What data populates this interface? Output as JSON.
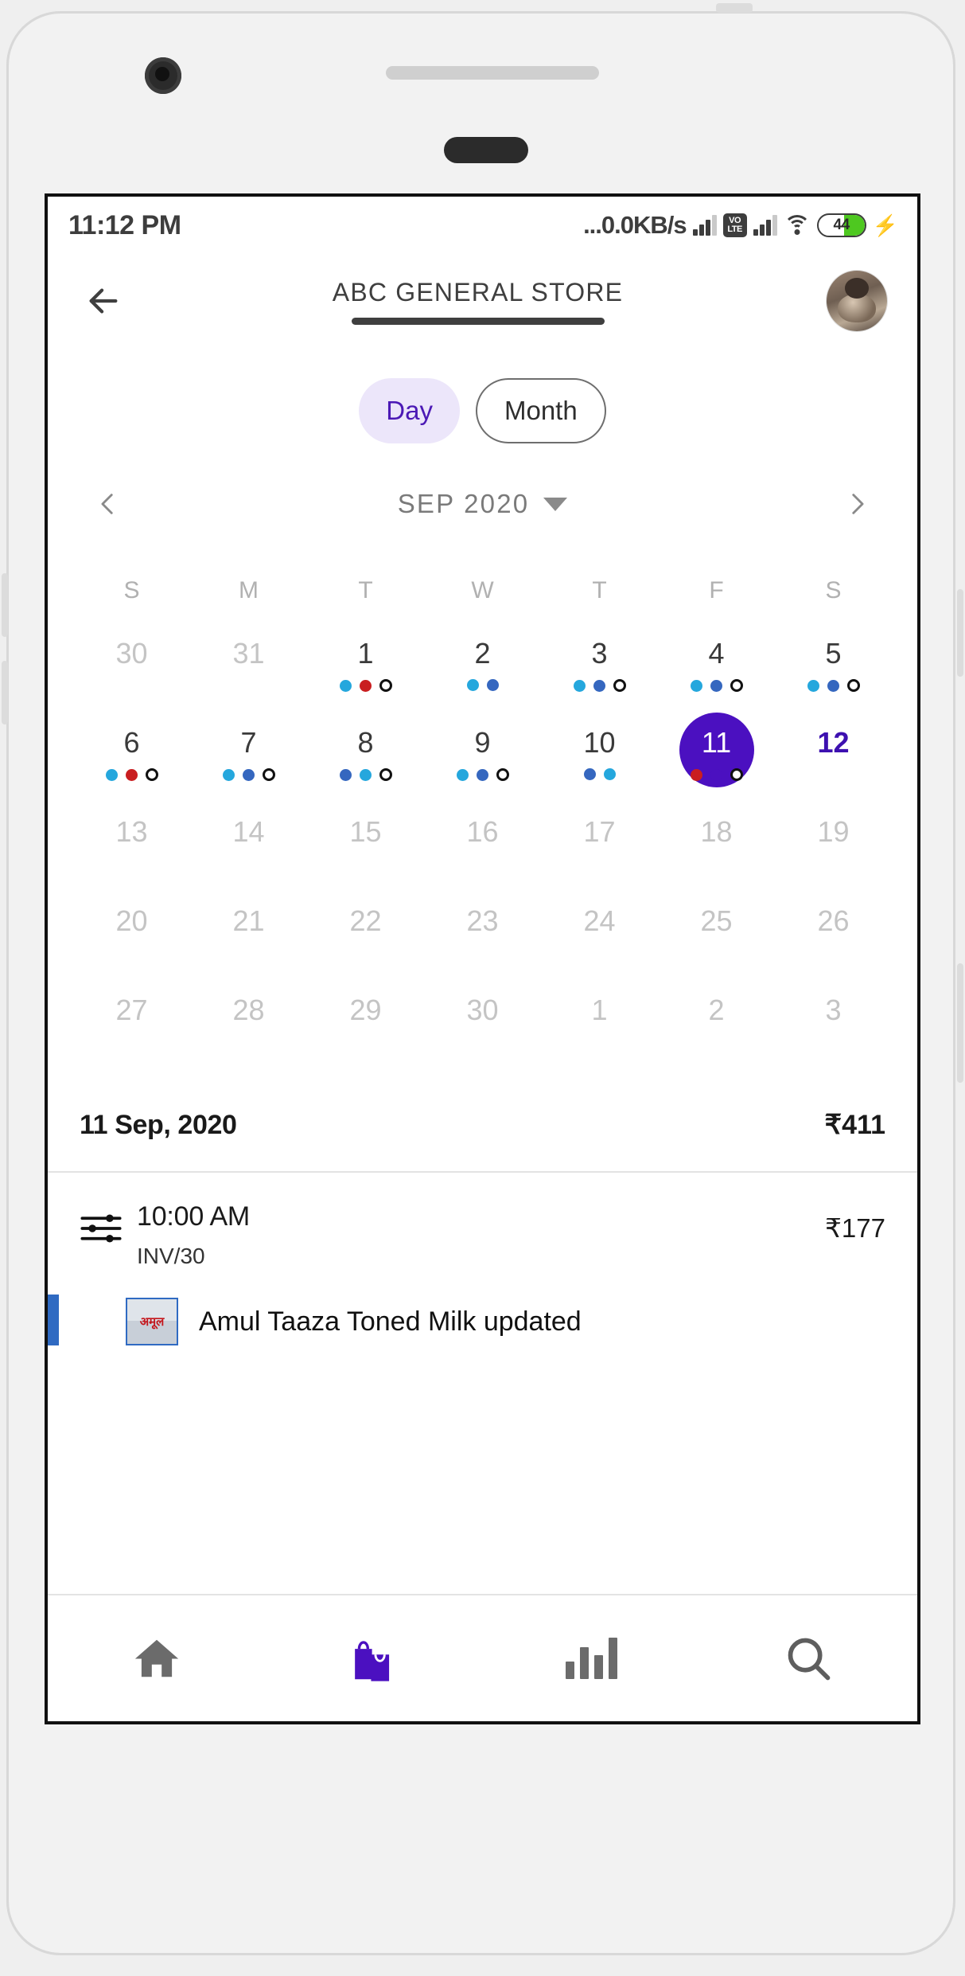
{
  "status_bar": {
    "time": "11:12 PM",
    "net_speed": "...0.0KB/s",
    "volte_top": "VO",
    "volte_bottom": "LTE",
    "battery_percent": "44",
    "battery_level": 44,
    "charging": true
  },
  "header": {
    "title": "ABC GENERAL STORE",
    "back_label": "Back",
    "avatar_label": "Profile"
  },
  "view_toggle": {
    "options": [
      {
        "label": "Day",
        "selected": true
      },
      {
        "label": "Month",
        "selected": false
      }
    ],
    "active_color": "#4b19b5",
    "active_bg": "#ece6fa"
  },
  "month_nav": {
    "prev_label": "Previous month",
    "next_label": "Next month",
    "month_label": "SEP 2020"
  },
  "calendar": {
    "day_headers": [
      "S",
      "M",
      "T",
      "W",
      "T",
      "F",
      "S"
    ],
    "accent_selected": "#4b10c0",
    "today_color": "#3d10b0",
    "dot_colors": {
      "lblue": "#25a7dd",
      "dblue": "#3567bf",
      "red": "#c91e20",
      "purple": "#4b10c0",
      "hollow": "#ffffff"
    },
    "weeks": [
      [
        {
          "num": "30",
          "muted": true,
          "dots": []
        },
        {
          "num": "31",
          "muted": true,
          "dots": []
        },
        {
          "num": "1",
          "muted": false,
          "dots": [
            "lblue",
            "red",
            "hollow"
          ]
        },
        {
          "num": "2",
          "muted": false,
          "dots": [
            "lblue",
            "dblue"
          ]
        },
        {
          "num": "3",
          "muted": false,
          "dots": [
            "lblue",
            "dblue",
            "hollow"
          ]
        },
        {
          "num": "4",
          "muted": false,
          "dots": [
            "lblue",
            "dblue",
            "hollow"
          ]
        },
        {
          "num": "5",
          "muted": false,
          "dots": [
            "lblue",
            "dblue",
            "hollow"
          ]
        }
      ],
      [
        {
          "num": "6",
          "muted": false,
          "dots": [
            "lblue",
            "red",
            "hollow"
          ]
        },
        {
          "num": "7",
          "muted": false,
          "dots": [
            "lblue",
            "dblue",
            "hollow"
          ]
        },
        {
          "num": "8",
          "muted": false,
          "dots": [
            "dblue",
            "lblue",
            "hollow"
          ]
        },
        {
          "num": "9",
          "muted": false,
          "dots": [
            "lblue",
            "dblue",
            "hollow"
          ]
        },
        {
          "num": "10",
          "muted": false,
          "dots": [
            "dblue",
            "lblue"
          ]
        },
        {
          "num": "11",
          "muted": false,
          "selected": true,
          "dots": [
            "red",
            "purple",
            "hollow"
          ]
        },
        {
          "num": "12",
          "muted": false,
          "today": true,
          "dots": []
        }
      ],
      [
        {
          "num": "13",
          "muted": true,
          "dots": []
        },
        {
          "num": "14",
          "muted": true,
          "dots": []
        },
        {
          "num": "15",
          "muted": true,
          "dots": []
        },
        {
          "num": "16",
          "muted": true,
          "dots": []
        },
        {
          "num": "17",
          "muted": true,
          "dots": []
        },
        {
          "num": "18",
          "muted": true,
          "dots": []
        },
        {
          "num": "19",
          "muted": true,
          "dots": []
        }
      ],
      [
        {
          "num": "20",
          "muted": true,
          "dots": []
        },
        {
          "num": "21",
          "muted": true,
          "dots": []
        },
        {
          "num": "22",
          "muted": true,
          "dots": []
        },
        {
          "num": "23",
          "muted": true,
          "dots": []
        },
        {
          "num": "24",
          "muted": true,
          "dots": []
        },
        {
          "num": "25",
          "muted": true,
          "dots": []
        },
        {
          "num": "26",
          "muted": true,
          "dots": []
        }
      ],
      [
        {
          "num": "27",
          "muted": true,
          "dots": []
        },
        {
          "num": "28",
          "muted": true,
          "dots": []
        },
        {
          "num": "29",
          "muted": true,
          "dots": []
        },
        {
          "num": "30",
          "muted": true,
          "dots": []
        },
        {
          "num": "1",
          "muted": true,
          "dots": []
        },
        {
          "num": "2",
          "muted": true,
          "dots": []
        },
        {
          "num": "3",
          "muted": true,
          "dots": []
        }
      ]
    ]
  },
  "summary": {
    "date": "11 Sep, 2020",
    "amount": "₹411"
  },
  "transactions": [
    {
      "icon": "sliders-icon",
      "time": "10:00 AM",
      "invoice": "INV/30",
      "amount": "₹177"
    }
  ],
  "product_row": {
    "thumb_text": "अमूल",
    "name": "Amul Taaza Toned Milk updated",
    "bar_color": "#2f6ac2"
  },
  "bottom_nav": {
    "items": [
      {
        "icon": "home-icon",
        "label": "Home",
        "active": false
      },
      {
        "icon": "bag-icon",
        "label": "Orders",
        "active": true
      },
      {
        "icon": "chart-icon",
        "label": "Reports",
        "active": false
      },
      {
        "icon": "search-icon",
        "label": "Search",
        "active": false
      }
    ],
    "active_color": "#4b10c0",
    "inactive_color": "#6b6b6b"
  }
}
